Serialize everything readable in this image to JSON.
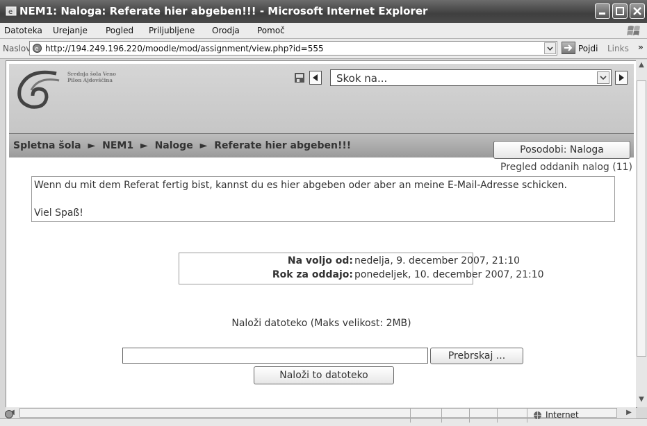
{
  "window": {
    "title": "NEM1: Naloga: Referate hier abgeben!!! - Microsoft Internet Explorer"
  },
  "menu": {
    "items": [
      "Datoteka",
      "Urejanje",
      "Pogled",
      "Priljubljene",
      "Orodja",
      "Pomoč"
    ]
  },
  "address": {
    "label": "Naslov",
    "url": "http://194.249.196.220/moodle/mod/assignment/view.php?id=555",
    "go_label": "Pojdi",
    "links_label": "Links",
    "chevron": "»"
  },
  "header": {
    "school_name": "Srednja šola Veno Pilon Ajdovščina",
    "jump_placeholder": "Skok na..."
  },
  "breadcrumb": {
    "items": [
      "Spletna šola",
      "NEM1",
      "Naloge",
      "Referate hier abgeben!!!"
    ],
    "separator": "►"
  },
  "update_button": "Posodobi: Naloga",
  "submissions_link": "Pregled oddanih nalog (11)",
  "intro": {
    "line1": "Wenn du mit dem Referat fertig bist, kannst du es hier abgeben oder aber an meine E-Mail-Adresse schicken.",
    "line2": "Viel Spaß!"
  },
  "dates": {
    "available_label": "Na voljo od:",
    "available_value": "nedelja, 9. december 2007, 21:10",
    "due_label": "Rok za oddajo:",
    "due_value": "ponedeljek, 10. december 2007, 21:10"
  },
  "upload": {
    "label": "Naloži datoteko (Maks velikost: 2MB)",
    "browse_button": "Prebrskaj ...",
    "submit_button": "Naloži to datoteko"
  },
  "statusbar": {
    "zone": "Internet"
  }
}
